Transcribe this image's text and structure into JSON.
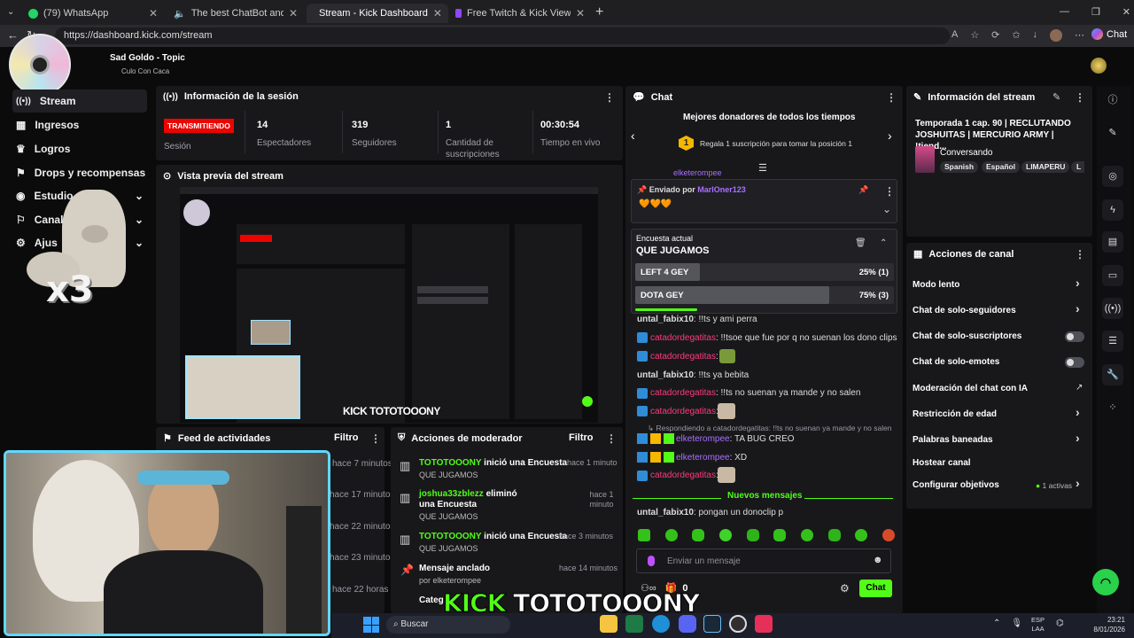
{
  "browser": {
    "tabs": [
      {
        "title": "(79) WhatsApp"
      },
      {
        "title": "The best ChatBot and Widget"
      },
      {
        "title": "Stream - Kick Dashboard"
      },
      {
        "title": "Free Twitch & Kick Viewers - Try 1"
      }
    ],
    "new_tab": "+",
    "url": "https://dashboard.kick.com/stream",
    "chat_label": "Chat"
  },
  "header": {
    "song_title": "Sad Goldo - Topic",
    "song_subtitle": "Culo Con Caca"
  },
  "sidebar": {
    "items": [
      {
        "label": "Stream"
      },
      {
        "label": "Ingresos"
      },
      {
        "label": "Logros"
      },
      {
        "label": "Drops y recompensas"
      },
      {
        "label": "Estudio"
      },
      {
        "label": "Canal"
      },
      {
        "label": "Ajus"
      }
    ],
    "sticker_text": "x3"
  },
  "session": {
    "title": "Información de la sesión",
    "live_badge": "TRANSMITIENDO",
    "session_label": "Sesión",
    "stats": [
      {
        "value": "14",
        "label": "Espectadores"
      },
      {
        "value": "319",
        "label": "Seguidores"
      },
      {
        "value": "1",
        "label": "Cantidad de suscripciones"
      },
      {
        "value": "00:30:54",
        "label": "Tiempo en vivo"
      }
    ]
  },
  "preview": {
    "title": "Vista previa del stream",
    "overlay_text": "KICK TOTOTOOONY"
  },
  "activity": {
    "title": "Feed de actividades",
    "filter": "Filtro",
    "times": [
      "hace 7 minutos",
      "hace 17 minutos",
      "hace 22 minutos",
      "hace 23 minutos",
      "hace 22 horas"
    ]
  },
  "modactions": {
    "title": "Acciones de moderador",
    "filter": "Filtro",
    "items": [
      {
        "user": "TOTOTOOONY",
        "action": " inició una Encuesta",
        "detail": "QUE JUGAMOS",
        "time": "hace 1 minuto"
      },
      {
        "user": "joshua33zblezz",
        "action": " eliminó una Encuesta",
        "detail": "QUE JUGAMOS",
        "time": "hace 1 minuto"
      },
      {
        "user": "TOTOTOOONY",
        "action": " inició una Encuesta",
        "detail": "QUE JUGAMOS",
        "time": "hace 3 minutos"
      },
      {
        "user": "Mensaje anclado",
        "action": "",
        "detail": "por elketerompee",
        "time": "hace 14 minutos"
      }
    ],
    "cut_text": "Categ"
  },
  "chat": {
    "title": "Chat",
    "donors_title": "Mejores donadores de todos los tiempos",
    "donor_rank": "1",
    "donor_cta": "Regala 1 suscripción para tomar la posición 1",
    "top_cut_user": "elketerompee",
    "pinned_label": "Enviado por",
    "pinned_user": "MarlOner123",
    "poll": {
      "label": "Encuesta actual",
      "question": "QUE JUGAMOS",
      "options": [
        {
          "name": "LEFT 4 GEY",
          "result": "25% (1)",
          "pct": 25
        },
        {
          "name": "DOTA GEY",
          "result": "75% (3)",
          "pct": 75
        }
      ]
    },
    "messages": [
      {
        "user": "untal_fabix10",
        "text": ": !!ts y ami perra"
      },
      {
        "user": "catadordegatitas",
        "text": ": !!tsoe que fue por q no suenan los dono clips"
      },
      {
        "user": "catadordegatitas",
        "text": ":"
      },
      {
        "user": "untal_fabix10",
        "text": ": !!ts ya bebita"
      },
      {
        "user": "catadordegatitas",
        "text": ": !!ts no suenan ya mande y no salen"
      },
      {
        "user": "catadordegatitas",
        "text": ":"
      },
      {
        "user": "Respondiendo a catadordegatitas",
        "text": ": !!ts no suenan ya mande y no salen"
      },
      {
        "user": "elketerompee",
        "text": ": TA BUG CREO"
      },
      {
        "user": "elketerompee",
        "text": ": XD"
      },
      {
        "user": "catadordegatitas",
        "text": ":"
      }
    ],
    "new_messages": "Nuevos mensajes",
    "last_message": {
      "user": "untal_fabix10",
      "text": ": pongan un donoclip p"
    },
    "input_placeholder": "Enviar un mensaje",
    "points": "0",
    "send": "Chat"
  },
  "stream_info": {
    "title": "Información del stream",
    "stream_title": "Temporada 1 cap. 90 | RECLUTANDO JOSHUITAS | MERCURIO ARMY | !tiend...",
    "category": "Conversando",
    "tags": [
      "Spanish",
      "Español",
      "LIMAPERU",
      "L"
    ]
  },
  "channel_actions": {
    "title": "Acciones de canal",
    "items": [
      {
        "label": "Modo lento"
      },
      {
        "label": "Chat de solo-seguidores"
      },
      {
        "label": "Chat de solo-suscriptores"
      },
      {
        "label": "Chat de solo-emotes"
      },
      {
        "label": "Moderación del chat con IA"
      },
      {
        "label": "Restricción de edad"
      },
      {
        "label": "Palabras baneadas"
      },
      {
        "label": "Hostear canal"
      },
      {
        "label": "Configurar objetivos"
      }
    ],
    "goals_status": "1 activas"
  },
  "overlay": {
    "brand": "KICK",
    "name": "TOTOTOOONY"
  },
  "taskbar": {
    "search": "Buscar",
    "lang_top": "ESP",
    "lang_bottom": "LAA",
    "time": "23:21",
    "date": "8/01/2026"
  },
  "colors": {
    "kick_green": "#53fc18",
    "live_red": "#eb0400",
    "panel": "#18181b"
  }
}
